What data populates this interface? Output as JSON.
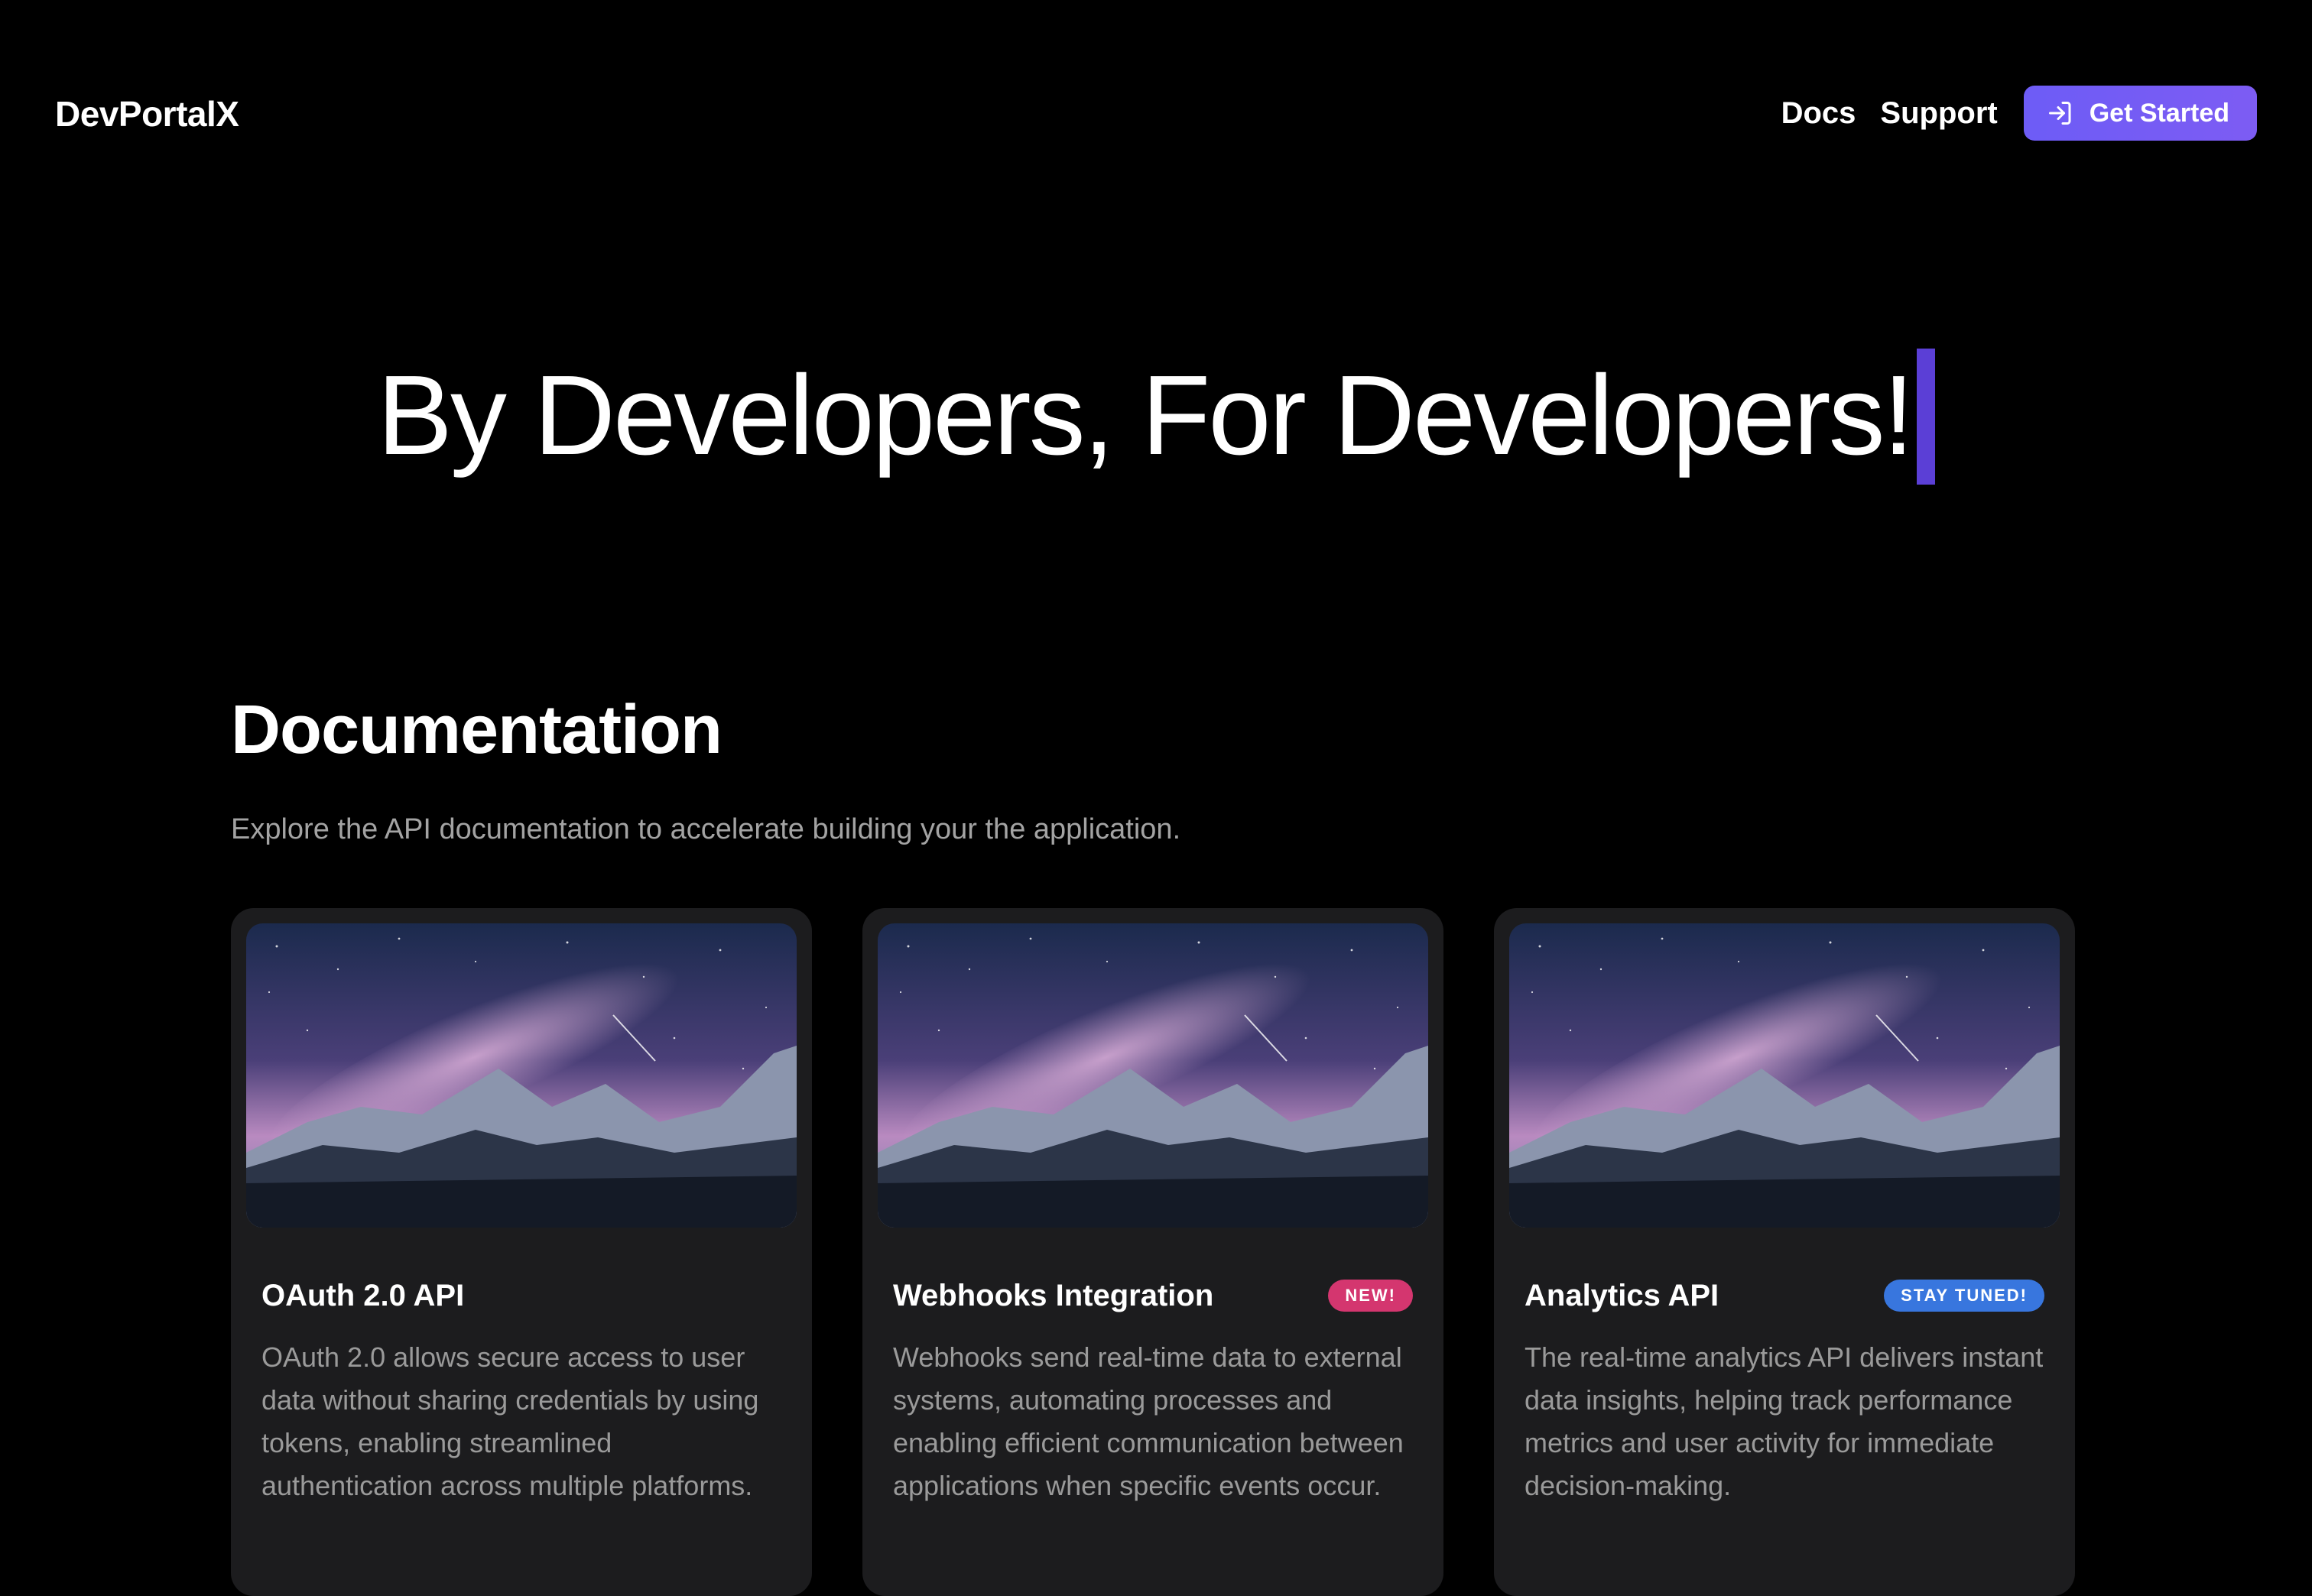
{
  "brand": {
    "name": "DevPortalX"
  },
  "nav": {
    "links": [
      "Docs",
      "Support"
    ],
    "cta_label": "Get Started",
    "cta_icon": "sign-in-icon"
  },
  "hero": {
    "title": "By Developers, For Developers!"
  },
  "documentation": {
    "title": "Documentation",
    "subtitle": "Explore the API documentation to accelerate building your the application.",
    "cards": [
      {
        "title": "OAuth 2.0 API",
        "badge": "",
        "description": "OAuth 2.0 allows secure access to user data without sharing credentials by using tokens, enabling streamlined authentication across multiple platforms."
      },
      {
        "title": "Webhooks Integration",
        "badge": "NEW!",
        "description": "Webhooks send real-time data to external systems, automating processes and enabling efficient communication between applications when specific events occur."
      },
      {
        "title": "Analytics API",
        "badge": "STAY TUNED!",
        "description": "The real-time analytics API delivers instant data insights, helping track performance metrics and user activity for immediate decision-making."
      }
    ]
  },
  "colors": {
    "accent": "#6d5cf6",
    "caret": "#5b3fd6",
    "badge_new": "#d4366f",
    "badge_tuned": "#3876de",
    "card_bg": "#1c1c1e"
  }
}
